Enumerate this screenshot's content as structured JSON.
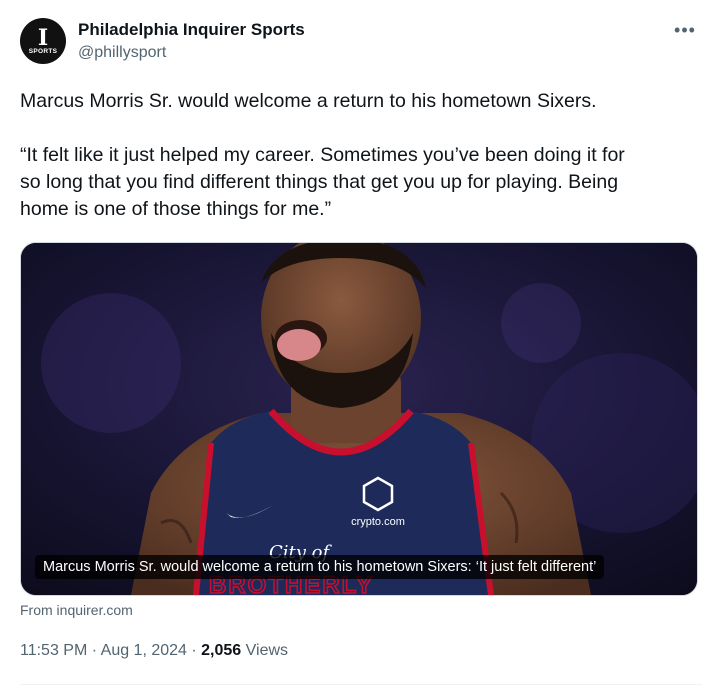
{
  "author": {
    "name": "Philadelphia Inquirer Sports",
    "handle": "@phillysport",
    "avatar_letter": "I",
    "avatar_sub": "SPORTS"
  },
  "more_icon": "more-horizontal-icon",
  "tweet": {
    "paragraph1": "Marcus Morris Sr. would welcome a return to his hometown Sixers.",
    "paragraph2_line1": "“It felt like it just helped my career. Sometimes you’ve been doing it for",
    "paragraph2_line2": "so long that you find different things that get you up for playing. Being",
    "paragraph2_line3": "home is one of those things for me.”"
  },
  "media": {
    "caption": "Marcus Morris Sr. would welcome a return to his hometown Sixers: ‘It just felt different’",
    "jersey_sponsor": "crypto.com",
    "jersey_script": "City of",
    "jersey_word": "BROTHERLY"
  },
  "source": {
    "label": "From inquirer.com"
  },
  "meta": {
    "time": "11:53 PM",
    "sep1": " · ",
    "date": "Aug 1, 2024",
    "sep2": " · ",
    "views_count": "2,056",
    "views_label": " Views"
  },
  "colors": {
    "text_primary": "#0f1419",
    "text_secondary": "#536471",
    "border": "#cfd9de",
    "jersey_navy": "#1d2a5a",
    "jersey_red": "#c8102e"
  }
}
